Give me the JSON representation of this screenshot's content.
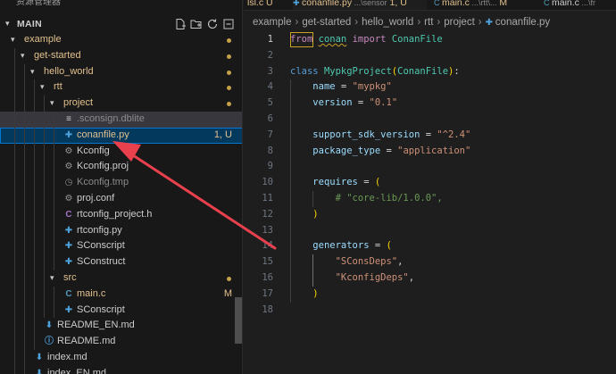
{
  "sidebar": {
    "title": "资源管理器",
    "section": "MAIN",
    "actions": [
      "new-file-icon",
      "new-folder-icon",
      "refresh-icon",
      "collapse-all-icon"
    ],
    "rows": [
      {
        "label": "example",
        "kind": "folder",
        "open": true,
        "depth": 0,
        "dot": true
      },
      {
        "label": "get-started",
        "kind": "folder",
        "open": true,
        "depth": 1,
        "dot": true
      },
      {
        "label": "hello_world",
        "kind": "folder",
        "open": true,
        "depth": 2,
        "dot": true
      },
      {
        "label": "rtt",
        "kind": "folder",
        "open": true,
        "depth": 3,
        "dot": true
      },
      {
        "label": "project",
        "kind": "folder",
        "open": true,
        "depth": 4,
        "dot": true
      },
      {
        "label": ".sconsign.dblite",
        "kind": "file",
        "icon": "≡",
        "depth": 5,
        "style": "dim",
        "selected": "muted"
      },
      {
        "label": "conanfile.py",
        "kind": "file",
        "icon": "✚",
        "iconColor": "#4fa3dc",
        "depth": 5,
        "style": "modified",
        "deco": "1, U",
        "selected": "active"
      },
      {
        "label": "Kconfig",
        "kind": "file",
        "icon": "⚙",
        "iconColor": "#9a9a9a",
        "depth": 5,
        "style": "normal"
      },
      {
        "label": "Kconfig.proj",
        "kind": "file",
        "icon": "⚙",
        "iconColor": "#9a9a9a",
        "depth": 5,
        "style": "normal"
      },
      {
        "label": "Kconfig.tmp",
        "kind": "file",
        "icon": "◷",
        "iconColor": "#8b8b8b",
        "depth": 5,
        "style": "dim"
      },
      {
        "label": "proj.conf",
        "kind": "file",
        "icon": "⚙",
        "iconColor": "#9a9a9a",
        "depth": 5,
        "style": "normal"
      },
      {
        "label": "rtconfig_project.h",
        "kind": "file",
        "icon": "C",
        "iconColor": "#a074c4",
        "depth": 5,
        "style": "normal"
      },
      {
        "label": "rtconfig.py",
        "kind": "file",
        "icon": "✚",
        "iconColor": "#4fa3dc",
        "depth": 5,
        "style": "normal"
      },
      {
        "label": "SConscript",
        "kind": "file",
        "icon": "✚",
        "iconColor": "#4fa3dc",
        "depth": 5,
        "style": "normal"
      },
      {
        "label": "SConstruct",
        "kind": "file",
        "icon": "✚",
        "iconColor": "#4fa3dc",
        "depth": 5,
        "style": "normal"
      },
      {
        "label": "src",
        "kind": "folder",
        "open": true,
        "depth": 4,
        "dot": true
      },
      {
        "label": "main.c",
        "kind": "file",
        "icon": "C",
        "iconColor": "#519aba",
        "depth": 5,
        "style": "modified",
        "deco": "M"
      },
      {
        "label": "SConscript",
        "kind": "file",
        "icon": "✚",
        "iconColor": "#4fa3dc",
        "depth": 5,
        "style": "normal"
      },
      {
        "label": "README_EN.md",
        "kind": "file",
        "icon": "⬇",
        "iconColor": "#4fa3dc",
        "depth": 3,
        "style": "normal"
      },
      {
        "label": "README.md",
        "kind": "file",
        "icon": "ⓘ",
        "iconColor": "#4fa3dc",
        "depth": 3,
        "style": "normal"
      },
      {
        "label": "index.md",
        "kind": "file",
        "icon": "⬇",
        "iconColor": "#4fa3dc",
        "depth": 2,
        "style": "normal"
      },
      {
        "label": "index_EN.md",
        "kind": "file",
        "icon": "⬇",
        "iconColor": "#4fa3dc",
        "depth": 2,
        "style": "normal"
      }
    ]
  },
  "tabs": [
    {
      "name": "lsl.c",
      "deco": "U",
      "partial": true
    },
    {
      "name": "conanfile.py",
      "path": "...\\sensor",
      "deco": "1, U",
      "active": true
    },
    {
      "name": "main.c",
      "path": "...\\rtt\\...",
      "deco": "M"
    },
    {
      "name": "main.c",
      "path": "...\\fr",
      "deco": ""
    }
  ],
  "breadcrumb": [
    "example",
    "get-started",
    "hello_world",
    "rtt",
    "project",
    "conanfile.py"
  ],
  "editor": {
    "lines": [
      [
        [
          "kw2",
          "from"
        ],
        [
          "op",
          " "
        ],
        [
          "cls",
          "conan"
        ],
        [
          "op",
          " "
        ],
        [
          "kw2",
          "import"
        ],
        [
          "op",
          " "
        ],
        [
          "cls",
          "ConanFile"
        ]
      ],
      [],
      [
        [
          "kw",
          "class"
        ],
        [
          "op",
          " "
        ],
        [
          "cls",
          "MypkgProject"
        ],
        [
          "br",
          "("
        ],
        [
          "cls",
          "ConanFile"
        ],
        [
          "br",
          ")"
        ],
        [
          "op",
          ":"
        ]
      ],
      [
        [
          "op",
          "    "
        ],
        [
          "var",
          "name"
        ],
        [
          "op",
          " = "
        ],
        [
          "str",
          "\"mypkg\""
        ]
      ],
      [
        [
          "op",
          "    "
        ],
        [
          "var",
          "version"
        ],
        [
          "op",
          " = "
        ],
        [
          "str",
          "\"0.1\""
        ]
      ],
      [],
      [
        [
          "op",
          "    "
        ],
        [
          "var",
          "support_sdk_version"
        ],
        [
          "op",
          " = "
        ],
        [
          "str",
          "\"^2.4\""
        ]
      ],
      [
        [
          "op",
          "    "
        ],
        [
          "var",
          "package_type"
        ],
        [
          "op",
          " = "
        ],
        [
          "str",
          "\"application\""
        ]
      ],
      [],
      [
        [
          "op",
          "    "
        ],
        [
          "var",
          "requires"
        ],
        [
          "op",
          " = "
        ],
        [
          "br",
          "("
        ]
      ],
      [
        [
          "op",
          "        "
        ],
        [
          "cmt",
          "# \"core-lib/1.0.0\","
        ]
      ],
      [
        [
          "op",
          "    "
        ],
        [
          "br",
          ")"
        ]
      ],
      [],
      [
        [
          "op",
          "    "
        ],
        [
          "var",
          "generators"
        ],
        [
          "op",
          " = "
        ],
        [
          "br",
          "("
        ]
      ],
      [
        [
          "op",
          "        "
        ],
        [
          "str",
          "\"SConsDeps\""
        ],
        [
          "op",
          ","
        ]
      ],
      [
        [
          "op",
          "        "
        ],
        [
          "str",
          "\"KconfigDeps\""
        ],
        [
          "op",
          ","
        ]
      ],
      [
        [
          "op",
          "    "
        ],
        [
          "br",
          ")"
        ]
      ],
      []
    ]
  },
  "colors": {
    "background": "#1e1e1e",
    "sidebar": "#181818",
    "selection": "#04395e",
    "accent": "#0078d4",
    "arrow": "#e8414d",
    "modified": "#e2c08d"
  }
}
